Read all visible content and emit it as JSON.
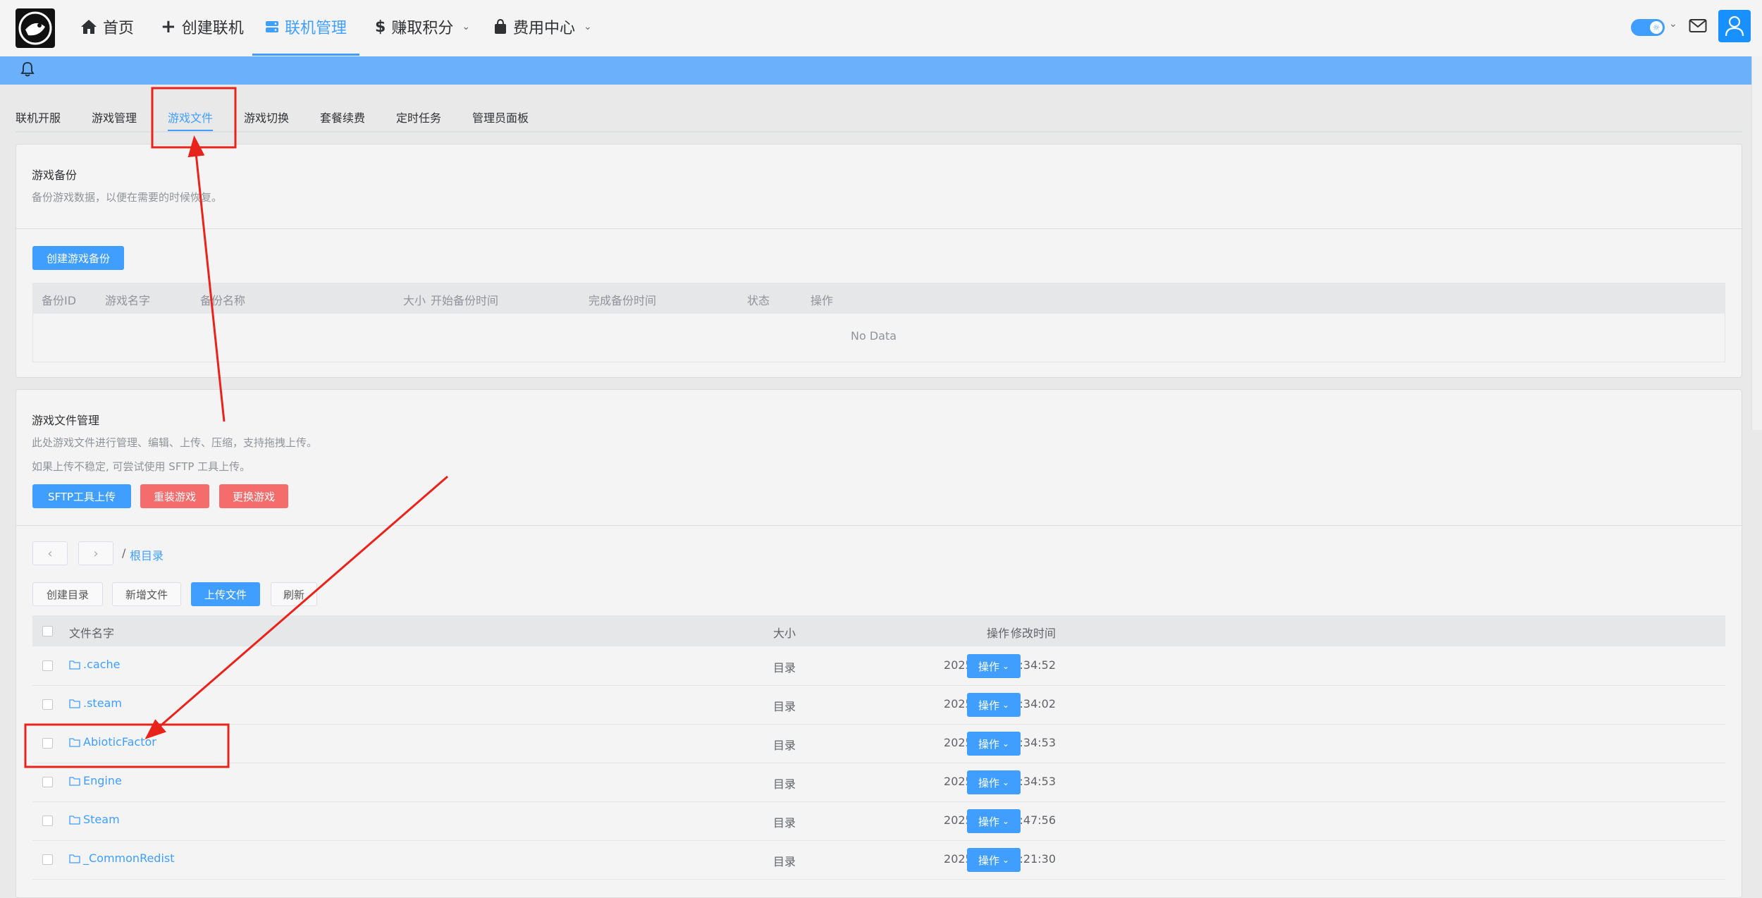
{
  "nav": {
    "items": [
      {
        "label": "首页",
        "icon": "home-icon"
      },
      {
        "label": "创建联机",
        "icon": "plus-icon"
      },
      {
        "label": "联机管理",
        "icon": "server-icon"
      },
      {
        "label": "赚取积分",
        "icon": "dollar-icon"
      },
      {
        "label": "费用中心",
        "icon": "bag-icon"
      }
    ]
  },
  "tabs": [
    "联机开服",
    "游戏管理",
    "游戏文件",
    "游戏切换",
    "套餐续费",
    "定时任务",
    "管理员面板"
  ],
  "backup": {
    "title": "游戏备份",
    "desc": "备份游戏数据，以便在需要的时候恢复。",
    "create_button": "创建游戏备份",
    "columns": [
      "备份ID",
      "游戏名字",
      "备份名称",
      "大小",
      "开始备份时间",
      "完成备份时间",
      "状态",
      "操作"
    ],
    "empty_text": "No Data"
  },
  "files": {
    "title": "游戏文件管理",
    "desc1": "此处游戏文件进行管理、编辑、上传、压缩，支持拖拽上传。",
    "desc2": "如果上传不稳定, 可尝试使用 SFTP 工具上传。",
    "sftp_button": "SFTP工具上传",
    "reinstall_button": "重装游戏",
    "change_button": "更换游戏",
    "breadcrumb_sep": "/",
    "breadcrumb_root": "根目录",
    "create_dir_button": "创建目录",
    "new_file_button": "新增文件",
    "upload_button": "上传文件",
    "refresh_button": "刷新",
    "columns": {
      "name": "文件名字",
      "size": "大小",
      "mtime": "修改时间",
      "ops": "操作"
    },
    "rows": [
      {
        "name": ".cache",
        "size": "目录",
        "mtime": "2025/7/23 11:34:52",
        "op": "操作"
      },
      {
        "name": ".steam",
        "size": "目录",
        "mtime": "2025/7/23 11:34:02",
        "op": "操作"
      },
      {
        "name": "AbioticFactor",
        "size": "目录",
        "mtime": "2025/7/23 11:34:53",
        "op": "操作"
      },
      {
        "name": "Engine",
        "size": "目录",
        "mtime": "2025/7/23 11:34:53",
        "op": "操作"
      },
      {
        "name": "Steam",
        "size": "目录",
        "mtime": "2025/3/26 16:47:56",
        "op": "操作"
      },
      {
        "name": "_CommonRedist",
        "size": "目录",
        "mtime": "2025/5/11 17:21:30",
        "op": "操作"
      }
    ]
  },
  "colors": {
    "accent": "#409eff",
    "danger": "#f56c6c",
    "annotation": "#e8231c",
    "banner": "#6ab0fb"
  }
}
